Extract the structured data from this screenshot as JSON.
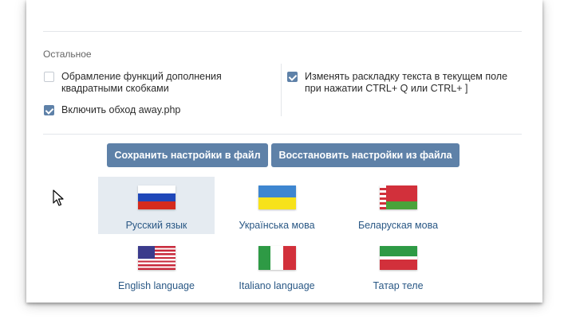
{
  "section": {
    "title": "Остальное"
  },
  "options": [
    {
      "label": "Обрамление функций дополнения квадратными скобками",
      "checked": false
    },
    {
      "label": "Включить обход away.php",
      "checked": true
    },
    {
      "label": "Изменять раскладку текста в текущем поле при нажатии CTRL+ Q или CTRL+ ]",
      "checked": true
    }
  ],
  "buttons": {
    "save": "Сохранить настройки в файл",
    "restore": "Восстановить настройки из файла"
  },
  "languages": [
    {
      "label": "Русский язык",
      "flag": "russia-flag",
      "selected": true
    },
    {
      "label": "Українська мова",
      "flag": "ukraine-flag",
      "selected": false
    },
    {
      "label": "Беларуская мова",
      "flag": "belarus-flag",
      "selected": false
    },
    {
      "label": "English language",
      "flag": "usa-flag",
      "selected": false
    },
    {
      "label": "Italiano language",
      "flag": "italy-flag",
      "selected": false
    },
    {
      "label": "Татар теле",
      "flag": "tatarstan-flag",
      "selected": false
    }
  ],
  "colors": {
    "accent": "#5e81a8",
    "link": "#2a5885",
    "selected_bg": "#e5ebf1"
  }
}
